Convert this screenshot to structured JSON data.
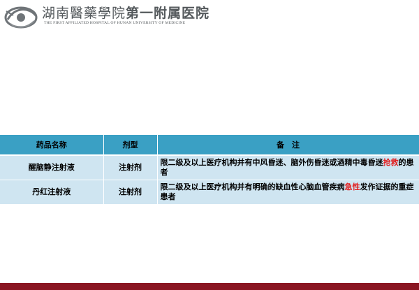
{
  "header": {
    "title_script": "湖南醫藥學院",
    "title_main": "第一附属医院",
    "subtitle": "THE FIRST AFFILIATED HOSPITAL OF HUNAN UNIVERSITY OF MEDICINE"
  },
  "table": {
    "headers": [
      "药品名称",
      "剂型",
      "备　注"
    ],
    "rows": [
      {
        "name": "醒脑静注射液",
        "form": "注射剂",
        "remark_a": "限二级及以上医疗机构并有中风昏迷、脑外伤昏迷或酒精中毒昏迷",
        "remark_highlight": "抢救",
        "remark_b": "的患者"
      },
      {
        "name": "丹红注射液",
        "form": "注射剂",
        "remark_a": "限二级及以上医疗机构并有明确的缺血性心脑血管疾病",
        "remark_highlight": "急性",
        "remark_b": "发作证据的重症患者"
      }
    ]
  },
  "colors": {
    "header_row": "#3aa0c4",
    "body_row": "#cfe5f1",
    "highlight": "#e11d1d",
    "bottom_bar": "#8a1622"
  }
}
